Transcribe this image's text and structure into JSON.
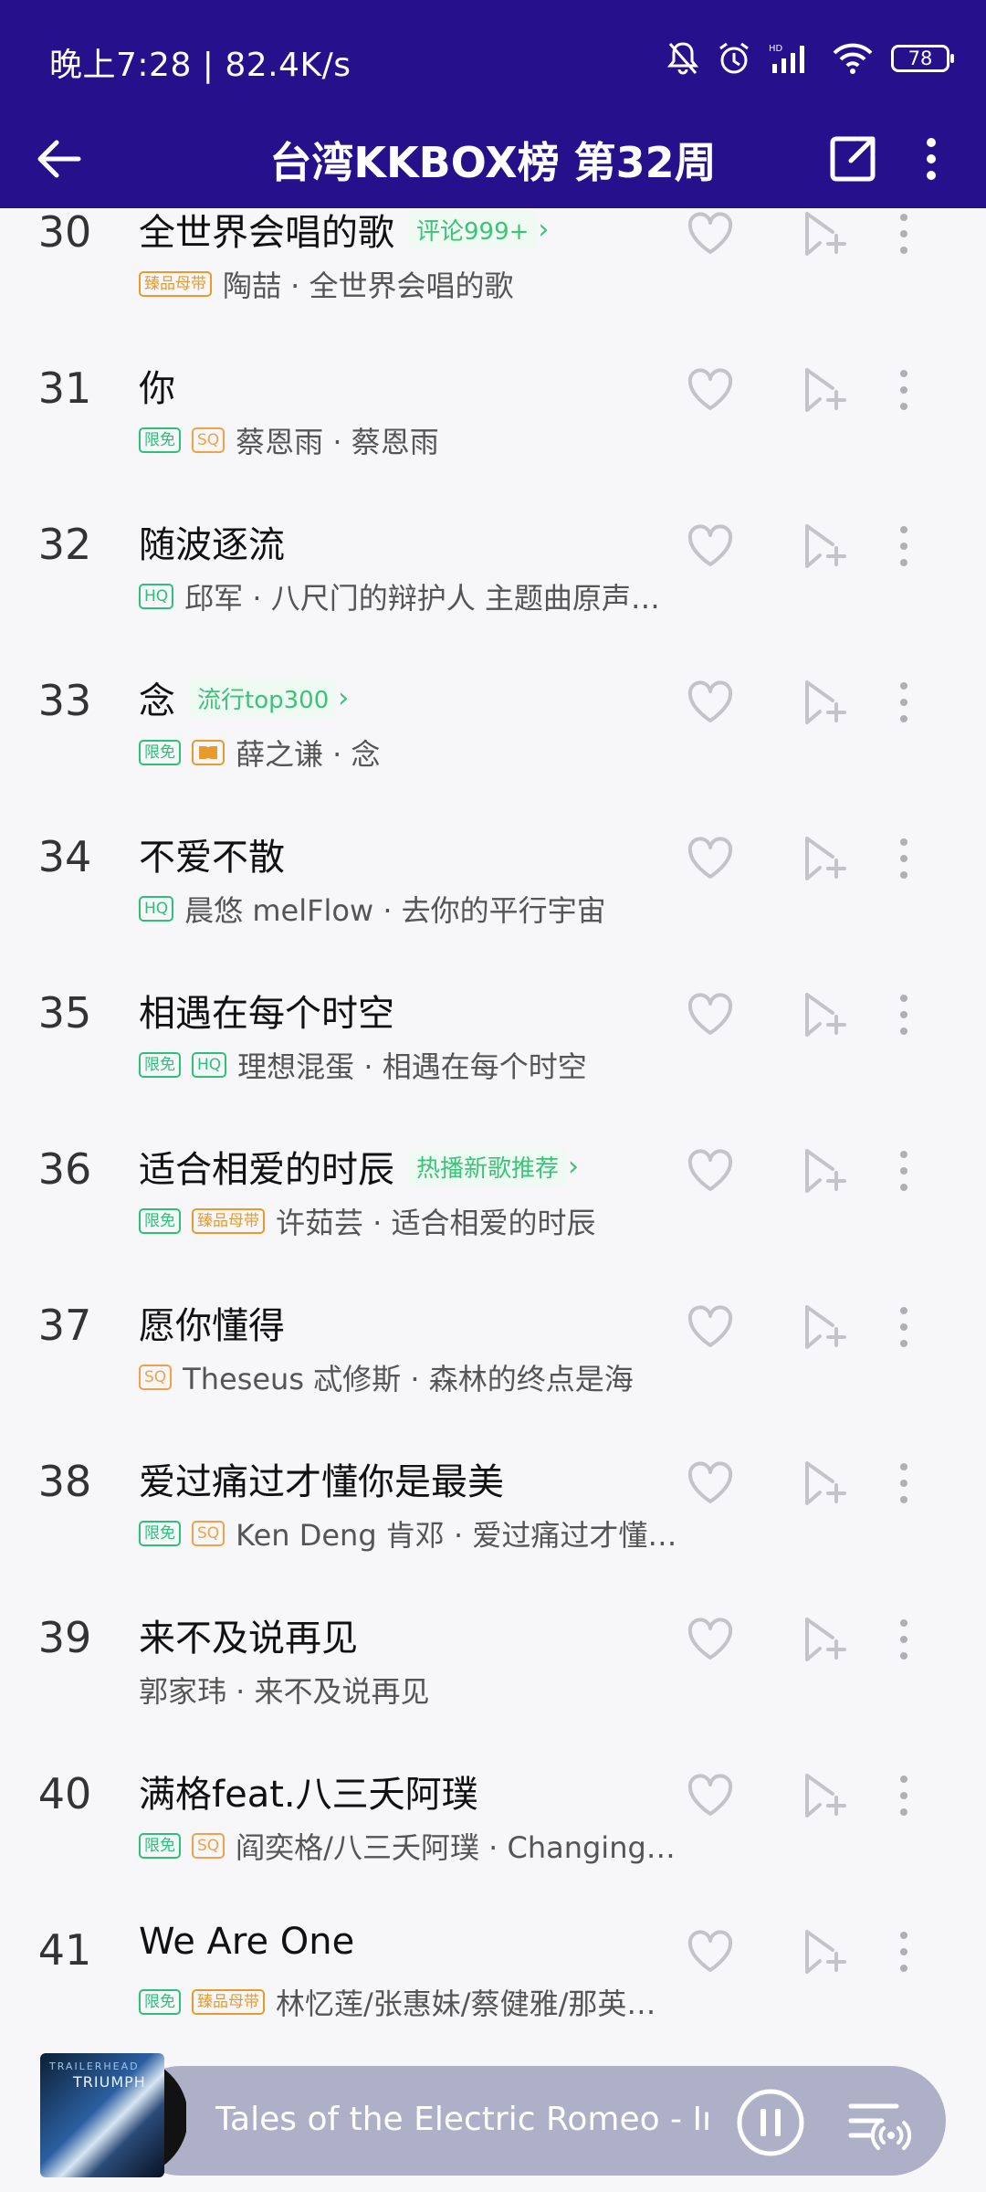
{
  "status_bar": {
    "time": "晚上7:28 | 82.4K/s",
    "battery": "78",
    "icons": [
      "bell-off-icon",
      "alarm-icon",
      "signal-icon",
      "wifi-icon",
      "battery-icon"
    ]
  },
  "app_bar": {
    "title": "台湾KKBOX榜 第32周",
    "back_icon": "arrow-left-icon",
    "share_icon": "share-icon",
    "more_icon": "more-vertical-icon"
  },
  "songs": [
    {
      "rank": "30",
      "title": "全世界会唱的歌",
      "tag": "评论999+",
      "badges": [
        {
          "text": "臻品母带",
          "type": "master"
        }
      ],
      "artist": "陶喆 · 全世界会唱的歌"
    },
    {
      "rank": "31",
      "title": "你",
      "tag": "",
      "badges": [
        {
          "text": "限免",
          "type": "free"
        },
        {
          "text": "SQ",
          "type": "sq"
        }
      ],
      "artist": "蔡恩雨 · 蔡恩雨"
    },
    {
      "rank": "32",
      "title": "随波逐流",
      "tag": "",
      "badges": [
        {
          "text": "HQ",
          "type": "hq"
        }
      ],
      "artist": "邱军 · 八尺门的辩护人 主题曲原声…"
    },
    {
      "rank": "33",
      "title": "念",
      "tag": "流行top300",
      "badges": [
        {
          "text": "限免",
          "type": "free"
        },
        {
          "text": "",
          "type": "dolby"
        }
      ],
      "artist": "薛之谦 · 念"
    },
    {
      "rank": "34",
      "title": "不爱不散",
      "tag": "",
      "badges": [
        {
          "text": "HQ",
          "type": "hq"
        }
      ],
      "artist": "晨悠 melFlow · 去你的平行宇宙"
    },
    {
      "rank": "35",
      "title": "相遇在每个时空",
      "tag": "",
      "badges": [
        {
          "text": "限免",
          "type": "free"
        },
        {
          "text": "HQ",
          "type": "hq"
        }
      ],
      "artist": "理想混蛋 · 相遇在每个时空"
    },
    {
      "rank": "36",
      "title": "适合相爱的时辰",
      "tag": "热播新歌推荐",
      "badges": [
        {
          "text": "限免",
          "type": "free"
        },
        {
          "text": "臻品母带",
          "type": "master"
        }
      ],
      "artist": "许茹芸 · 适合相爱的时辰"
    },
    {
      "rank": "37",
      "title": "愿你懂得",
      "tag": "",
      "badges": [
        {
          "text": "SQ",
          "type": "sq"
        }
      ],
      "artist": "Theseus 忒修斯 · 森林的终点是海"
    },
    {
      "rank": "38",
      "title": "爱过痛过才懂你是最美",
      "tag": "",
      "badges": [
        {
          "text": "限免",
          "type": "free"
        },
        {
          "text": "SQ",
          "type": "sq"
        }
      ],
      "artist": "Ken Deng 肯邓 · 爱过痛过才懂…"
    },
    {
      "rank": "39",
      "title": "来不及说再见",
      "tag": "",
      "badges": [],
      "artist": "郭家玮 · 来不及说再见"
    },
    {
      "rank": "40",
      "title": "满格feat.八三夭阿璞",
      "tag": "",
      "badges": [
        {
          "text": "限免",
          "type": "free"
        },
        {
          "text": "SQ",
          "type": "sq"
        }
      ],
      "artist": "阎奕格/八三夭阿璞 · Changing…"
    },
    {
      "rank": "41",
      "title": "We Are One",
      "tag": "",
      "badges": [
        {
          "text": "限免",
          "type": "free"
        },
        {
          "text": "臻品母带",
          "type": "master"
        }
      ],
      "artist": "林忆莲/张惠妹/蔡健雅/那英…"
    }
  ],
  "player": {
    "now_playing": "Tales of the Electric Romeo - Imr",
    "album_label_top": "TRAILERHEAD",
    "album_label_main": "TRIUMPH",
    "pause_icon": "pause-icon",
    "queue_icon": "playlist-icon"
  }
}
